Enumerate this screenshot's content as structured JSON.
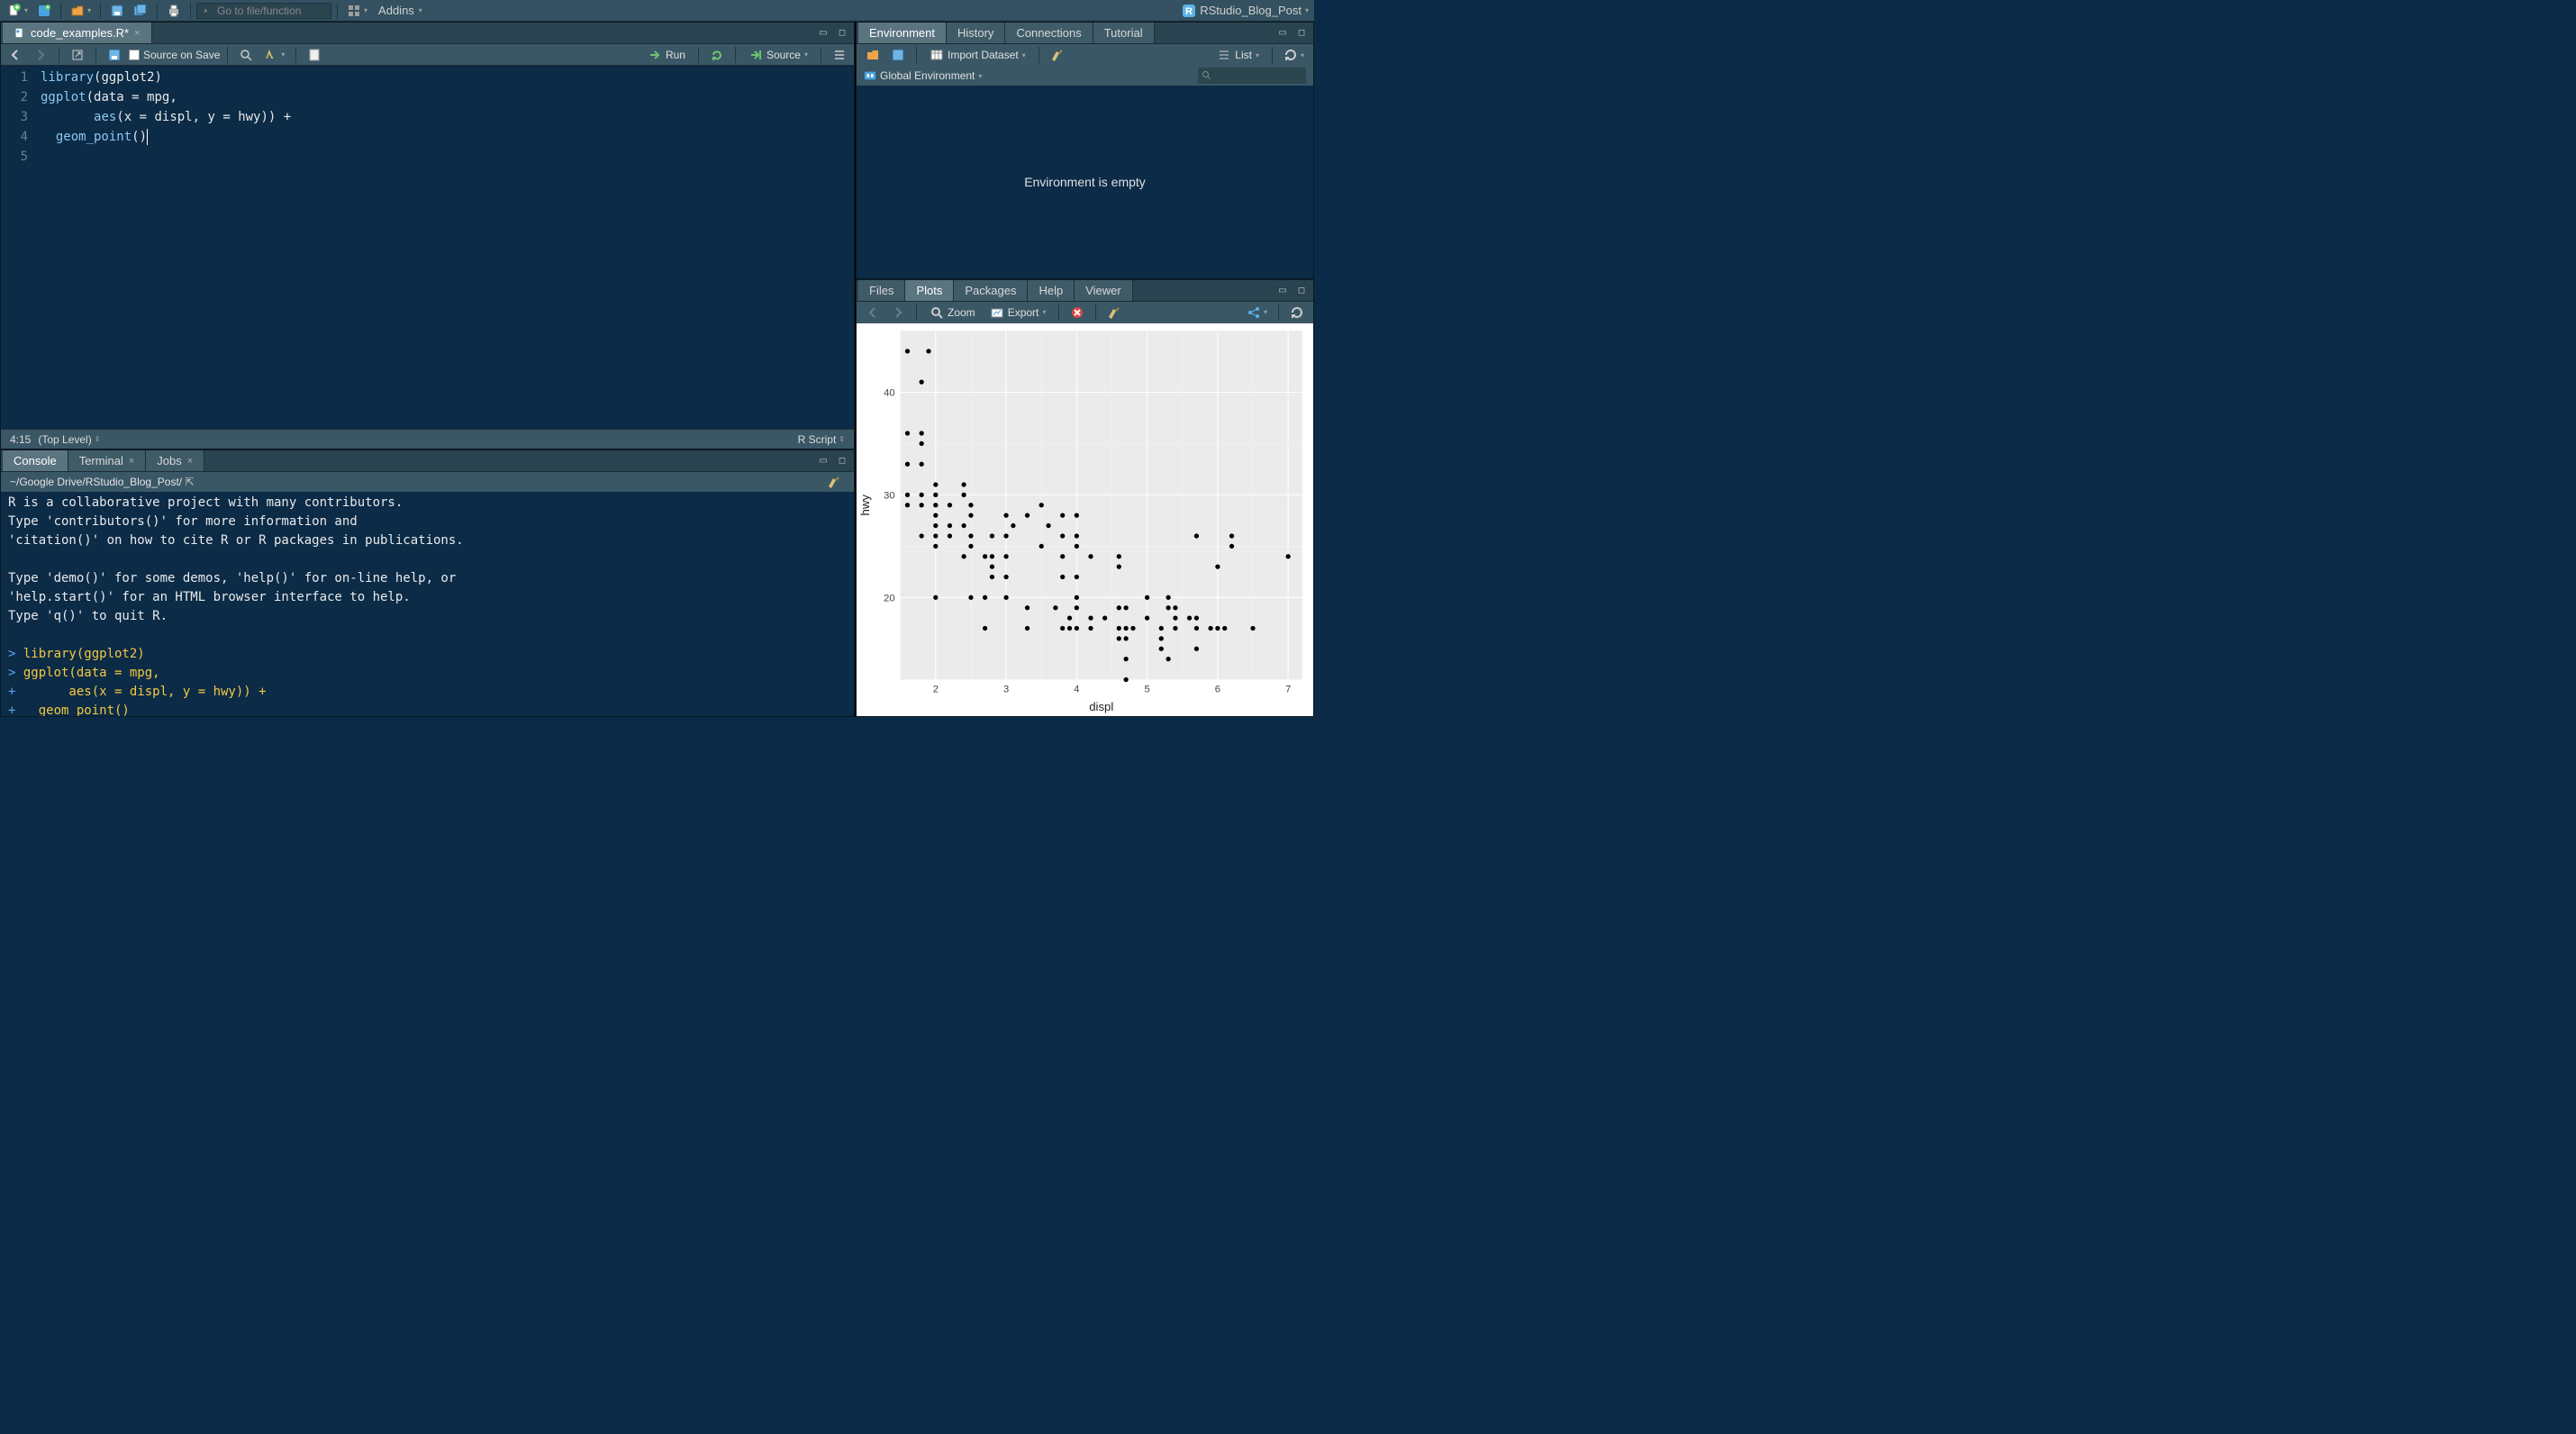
{
  "project_name": "RStudio_Blog_Post",
  "main_toolbar": {
    "goto_placeholder": "Go to file/function",
    "addins_label": "Addins"
  },
  "source_pane": {
    "tab_label": "code_examples.R*",
    "source_on_save_label": "Source on Save",
    "run_label": "Run",
    "source_label": "Source",
    "cursor_pos": "4:15",
    "scope_label": "(Top Level)",
    "filetype_label": "R Script",
    "code_lines": [
      {
        "n": 1,
        "segments": [
          {
            "t": "library",
            "c": "tok-fn"
          },
          {
            "t": "(",
            "c": "tok-paren"
          },
          {
            "t": "ggplot2",
            "c": "tok-id"
          },
          {
            "t": ")",
            "c": "tok-paren"
          }
        ]
      },
      {
        "n": 2,
        "segments": [
          {
            "t": "ggplot",
            "c": "tok-fn"
          },
          {
            "t": "(",
            "c": "tok-paren"
          },
          {
            "t": "data ",
            "c": "tok-id"
          },
          {
            "t": "= ",
            "c": "tok-op"
          },
          {
            "t": "mpg,",
            "c": "tok-id"
          }
        ]
      },
      {
        "n": 3,
        "segments": [
          {
            "t": "       ",
            "c": ""
          },
          {
            "t": "aes",
            "c": "tok-fn"
          },
          {
            "t": "(",
            "c": "tok-paren"
          },
          {
            "t": "x ",
            "c": "tok-id"
          },
          {
            "t": "= ",
            "c": "tok-op"
          },
          {
            "t": "displ, y ",
            "c": "tok-id"
          },
          {
            "t": "= ",
            "c": "tok-op"
          },
          {
            "t": "hwy",
            "c": "tok-id"
          },
          {
            "t": ")) ",
            "c": "tok-paren"
          },
          {
            "t": "+",
            "c": "tok-op"
          }
        ]
      },
      {
        "n": 4,
        "segments": [
          {
            "t": "  ",
            "c": ""
          },
          {
            "t": "geom_point",
            "c": "tok-fn"
          },
          {
            "t": "()",
            "c": "tok-paren"
          }
        ]
      },
      {
        "n": 5,
        "segments": []
      }
    ]
  },
  "console_pane": {
    "tabs": {
      "console": "Console",
      "terminal": "Terminal",
      "jobs": "Jobs"
    },
    "path": "~/Google Drive/RStudio_Blog_Post/",
    "lines": [
      {
        "c": "con-w",
        "t": "R is a collaborative project with many contributors."
      },
      {
        "c": "con-w",
        "t": "Type 'contributors()' for more information and"
      },
      {
        "c": "con-w",
        "t": "'citation()' on how to cite R or R packages in publications."
      },
      {
        "c": "con-w",
        "t": ""
      },
      {
        "c": "con-w",
        "t": "Type 'demo()' for some demos, 'help()' for on-line help, or"
      },
      {
        "c": "con-w",
        "t": "'help.start()' for an HTML browser interface to help."
      },
      {
        "c": "con-w",
        "t": "Type 'q()' to quit R."
      },
      {
        "c": "con-w",
        "t": ""
      },
      {
        "c": "con-b",
        "pre": "> ",
        "body": "library(ggplot2)",
        "bc": "con-y"
      },
      {
        "c": "con-b",
        "pre": "> ",
        "body": "ggplot(data = mpg,",
        "bc": "con-y"
      },
      {
        "c": "con-b",
        "pre": "+ ",
        "body": "      aes(x = displ, y = hwy)) +",
        "bc": "con-y"
      },
      {
        "c": "con-b",
        "pre": "+ ",
        "body": "  geom_point()",
        "bc": "con-y"
      },
      {
        "c": "con-b",
        "pre": "> ",
        "body": "",
        "bc": "con-y",
        "cursor": true
      }
    ]
  },
  "env_pane": {
    "tabs": {
      "env": "Environment",
      "hist": "History",
      "conn": "Connections",
      "tut": "Tutorial"
    },
    "import_label": "Import Dataset",
    "list_label": "List",
    "scope_label": "Global Environment",
    "empty_msg": "Environment is empty"
  },
  "plots_pane": {
    "tabs": {
      "files": "Files",
      "plots": "Plots",
      "packages": "Packages",
      "help": "Help",
      "viewer": "Viewer"
    },
    "zoom_label": "Zoom",
    "export_label": "Export"
  },
  "chart_data": {
    "type": "scatter",
    "title": "",
    "xlabel": "displ",
    "ylabel": "hwy",
    "xlim": [
      1.5,
      7.2
    ],
    "ylim": [
      12,
      46
    ],
    "x_ticks": [
      2,
      3,
      4,
      5,
      6,
      7
    ],
    "y_ticks": [
      20,
      30,
      40
    ],
    "points": [
      [
        1.6,
        33
      ],
      [
        1.6,
        30
      ],
      [
        1.6,
        29
      ],
      [
        1.6,
        36
      ],
      [
        1.6,
        44
      ],
      [
        1.8,
        29
      ],
      [
        1.8,
        26
      ],
      [
        1.8,
        30
      ],
      [
        1.8,
        36
      ],
      [
        1.8,
        33
      ],
      [
        1.8,
        35
      ],
      [
        1.8,
        41
      ],
      [
        1.9,
        44
      ],
      [
        2.0,
        31
      ],
      [
        2.0,
        30
      ],
      [
        2.0,
        29
      ],
      [
        2.0,
        28
      ],
      [
        2.0,
        27
      ],
      [
        2.0,
        26
      ],
      [
        2.0,
        25
      ],
      [
        2.0,
        20
      ],
      [
        2.2,
        27
      ],
      [
        2.2,
        26
      ],
      [
        2.2,
        29
      ],
      [
        2.4,
        30
      ],
      [
        2.4,
        31
      ],
      [
        2.4,
        27
      ],
      [
        2.4,
        24
      ],
      [
        2.5,
        26
      ],
      [
        2.5,
        25
      ],
      [
        2.5,
        28
      ],
      [
        2.5,
        29
      ],
      [
        2.5,
        20
      ],
      [
        2.7,
        24
      ],
      [
        2.7,
        20
      ],
      [
        2.7,
        17
      ],
      [
        2.8,
        26
      ],
      [
        2.8,
        24
      ],
      [
        2.8,
        23
      ],
      [
        2.8,
        22
      ],
      [
        3.0,
        26
      ],
      [
        3.0,
        28
      ],
      [
        3.0,
        24
      ],
      [
        3.0,
        22
      ],
      [
        3.0,
        20
      ],
      [
        3.1,
        27
      ],
      [
        3.3,
        28
      ],
      [
        3.3,
        19
      ],
      [
        3.3,
        17
      ],
      [
        3.5,
        29
      ],
      [
        3.5,
        25
      ],
      [
        3.6,
        27
      ],
      [
        3.7,
        19
      ],
      [
        3.8,
        26
      ],
      [
        3.8,
        28
      ],
      [
        3.8,
        24
      ],
      [
        3.8,
        22
      ],
      [
        3.8,
        17
      ],
      [
        3.9,
        18
      ],
      [
        3.9,
        17
      ],
      [
        4.0,
        20
      ],
      [
        4.0,
        22
      ],
      [
        4.0,
        25
      ],
      [
        4.0,
        17
      ],
      [
        4.0,
        19
      ],
      [
        4.0,
        26
      ],
      [
        4.0,
        28
      ],
      [
        4.2,
        18
      ],
      [
        4.2,
        17
      ],
      [
        4.2,
        24
      ],
      [
        4.4,
        18
      ],
      [
        4.6,
        19
      ],
      [
        4.6,
        24
      ],
      [
        4.6,
        23
      ],
      [
        4.6,
        16
      ],
      [
        4.6,
        17
      ],
      [
        4.7,
        17
      ],
      [
        4.7,
        19
      ],
      [
        4.7,
        12
      ],
      [
        4.7,
        14
      ],
      [
        4.7,
        16
      ],
      [
        4.8,
        17
      ],
      [
        5.0,
        18
      ],
      [
        5.0,
        20
      ],
      [
        5.2,
        17
      ],
      [
        5.2,
        15
      ],
      [
        5.2,
        16
      ],
      [
        5.3,
        20
      ],
      [
        5.3,
        19
      ],
      [
        5.3,
        14
      ],
      [
        5.4,
        17
      ],
      [
        5.4,
        18
      ],
      [
        5.4,
        19
      ],
      [
        5.6,
        18
      ],
      [
        5.7,
        17
      ],
      [
        5.7,
        26
      ],
      [
        5.7,
        15
      ],
      [
        5.7,
        18
      ],
      [
        5.9,
        17
      ],
      [
        6.0,
        17
      ],
      [
        6.0,
        23
      ],
      [
        6.1,
        17
      ],
      [
        6.2,
        25
      ],
      [
        6.2,
        26
      ],
      [
        6.5,
        17
      ],
      [
        7.0,
        24
      ]
    ]
  }
}
